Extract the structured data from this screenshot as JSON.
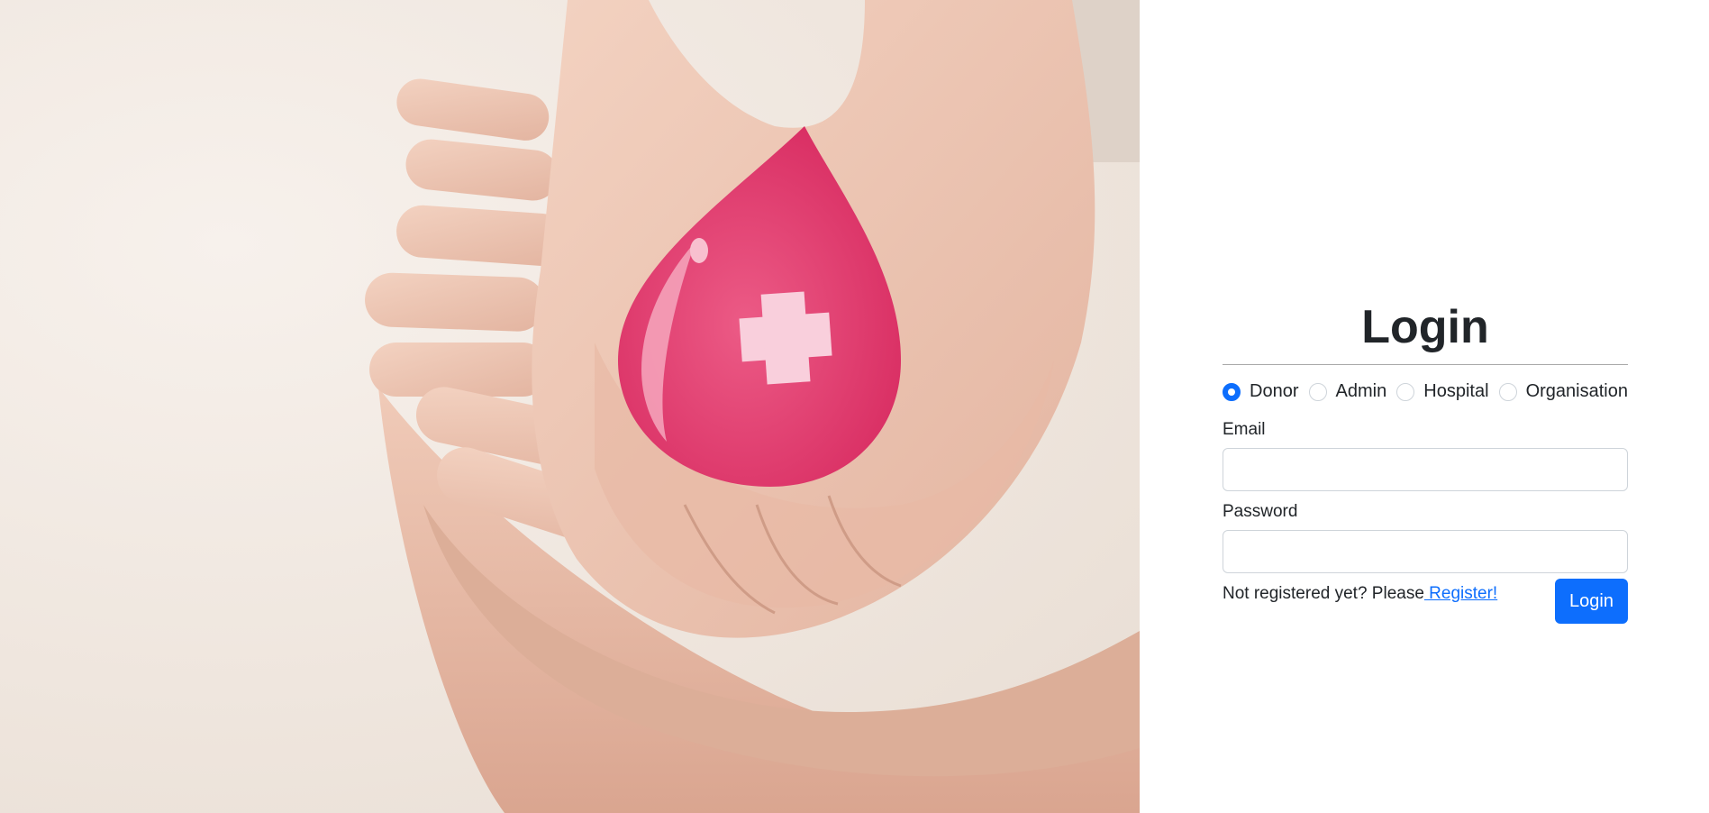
{
  "hero": {
    "image_subject": "hands-holding-blood-drop-icon"
  },
  "login": {
    "title": "Login",
    "roles": [
      {
        "label": "Donor",
        "checked": true
      },
      {
        "label": "Admin",
        "checked": false
      },
      {
        "label": "Hospital",
        "checked": false
      },
      {
        "label": "Organisation",
        "checked": false
      }
    ],
    "email_label": "Email",
    "email_value": "",
    "password_label": "Password",
    "password_value": "",
    "register_prompt": "Not registered yet? Please",
    "register_link": " Register!",
    "submit_label": "Login"
  },
  "colors": {
    "accent": "#0d6efd",
    "drop": "#e23d6e",
    "text": "#212529"
  }
}
